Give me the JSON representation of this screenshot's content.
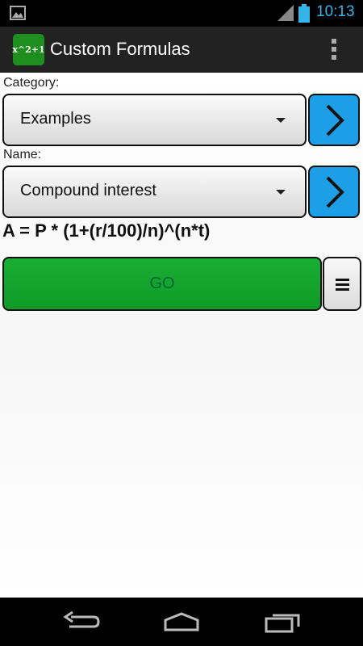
{
  "status_bar": {
    "time": "10:13",
    "icons": [
      "gallery-icon",
      "signal-icon",
      "battery-icon"
    ],
    "accent_color": "#33b5e5"
  },
  "action_bar": {
    "app_icon_text": "x^2+1",
    "title": "Custom Formulas",
    "overflow_icon": "overflow-menu-icon"
  },
  "form": {
    "category_label": "Category:",
    "category_value": "Examples",
    "name_label": "Name:",
    "name_value": "Compound interest",
    "formula": "A = P * (1+(r/100)/n)^(n*t)",
    "go_label": "GO",
    "go_color": "#15a52e",
    "next_button_color": "#1c9fe6"
  },
  "nav_bar": {
    "icons": [
      "back-icon",
      "home-icon",
      "recent-apps-icon"
    ]
  }
}
